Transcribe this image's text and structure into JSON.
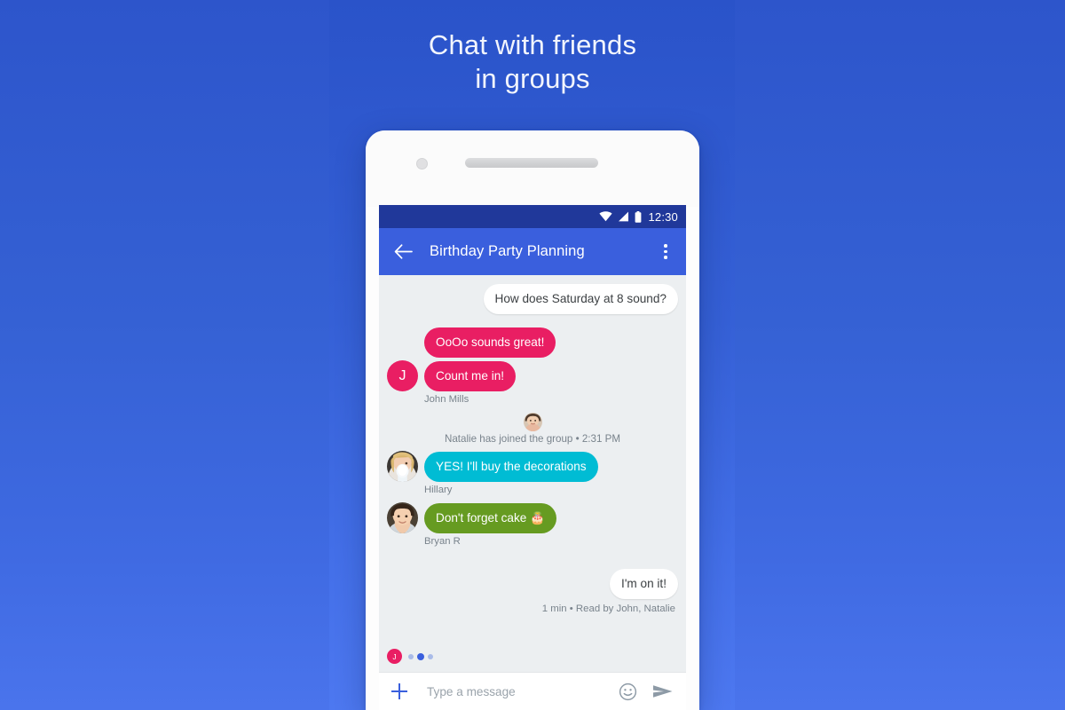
{
  "promo": {
    "headline_line1": "Chat with friends",
    "headline_line2": "in groups",
    "background_top_color": "#2a53c9",
    "background_bottom_color": "#4d78f0"
  },
  "phone": {
    "status_bar": {
      "time": "12:30",
      "background_color": "#20389a",
      "icons": [
        "wifi-icon",
        "cell-signal-icon",
        "battery-icon"
      ]
    },
    "app_bar": {
      "title": "Birthday Party Planning",
      "background_color": "#3a5fdd",
      "back_icon": "arrow-back-icon",
      "overflow_icon": "more-vertical-icon"
    },
    "conversation": {
      "background_color": "#eceff1",
      "messages": [
        {
          "id": "msg-saturday",
          "text": "How does Saturday at 8 sound?",
          "side": "right",
          "bubble_style": "incoming-white",
          "bubble_color": "#ffffff"
        },
        {
          "id": "msg-oooo",
          "text": "OoOo sounds great!",
          "side": "left",
          "bubble_style": "pink",
          "bubble_color": "#e91e63"
        },
        {
          "id": "msg-count-me-in",
          "text": "Count me in!",
          "side": "left",
          "bubble_style": "pink",
          "bubble_color": "#e91e63",
          "avatar_initial": "J",
          "sender": "John Mills"
        },
        {
          "id": "msg-decorations",
          "text": "YES! I'll buy the decorations",
          "side": "left",
          "bubble_style": "cyan",
          "bubble_color": "#00bcd4",
          "sender": "Hillary"
        },
        {
          "id": "msg-cake",
          "text": "Don't forget cake 🎂",
          "side": "left",
          "bubble_style": "green",
          "bubble_color": "#669b21",
          "sender": "Bryan R"
        },
        {
          "id": "msg-im-on-it",
          "text": "I'm on it!",
          "side": "right",
          "bubble_style": "outgoing-white",
          "bubble_color": "#ffffff"
        }
      ],
      "join_notice": {
        "text": "Natalie has joined the group • 2:31 PM",
        "avatar": "natalie-avatar"
      },
      "read_receipt": "1 min • Read by John, Natalie",
      "typing_indicator": {
        "avatar_initial": "J",
        "dot_color": "#3a5fdd"
      }
    },
    "composer": {
      "attach_icon": "plus-icon",
      "placeholder": "Type a message",
      "value": "",
      "emoji_icon": "emoji-smiley-icon",
      "send_icon": "send-paper-plane-icon"
    }
  }
}
